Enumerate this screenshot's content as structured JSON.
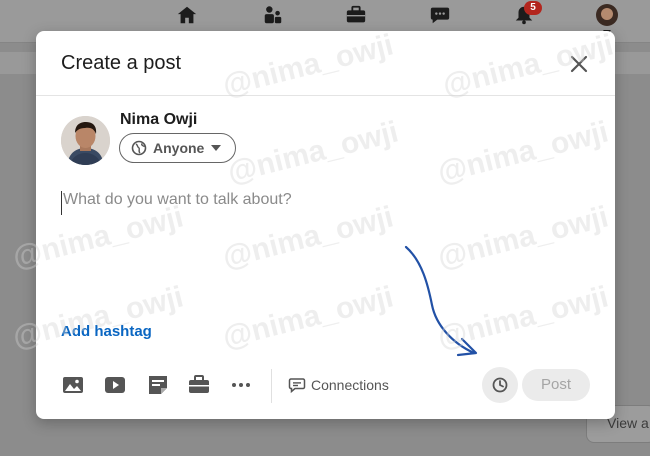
{
  "nav": {
    "notification_count": "5",
    "icons": [
      "home-icon",
      "network-icon",
      "jobs-icon",
      "messaging-icon",
      "notifications-icon",
      "me-avatar"
    ]
  },
  "modal": {
    "title": "Create a post",
    "author_name": "Nima Owji",
    "audience": "Anyone",
    "composer_placeholder": "What do you want to talk about?",
    "hashtag_label": "Add hashtag",
    "toolbar": {
      "icons": [
        "photo-icon",
        "video-icon",
        "document-icon",
        "job-icon",
        "more-icon"
      ],
      "visibility_label": "Connections"
    },
    "post_label": "Post"
  },
  "background": {
    "view_label": "View a"
  },
  "watermark": "@nima_owji",
  "colors": {
    "link_blue": "#0a66c2",
    "badge_red": "#b3261e",
    "arrow_blue": "#2251a6",
    "disabled_gray": "#a5a5a5"
  }
}
